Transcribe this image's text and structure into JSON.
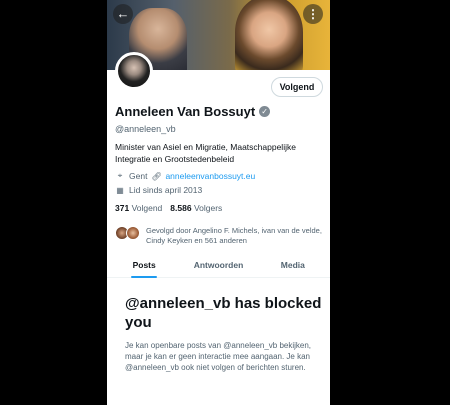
{
  "header": {
    "back_icon": "arrow-left-icon",
    "more_icon": "more-vertical-icon"
  },
  "profile": {
    "follow_label": "Volgend",
    "name": "Anneleen Van Bossuyt",
    "verified_icon": "verified-badge-icon",
    "handle": "@anneleen_vb",
    "bio": "Minister van Asiel en Migratie, Maatschappelijke Integratie en Grootstedenbeleid",
    "location": "Gent",
    "website": "anneleenvanbossuyt.eu",
    "joined": "Lid sinds april 2013",
    "following_count": "371",
    "following_label": "Volgend",
    "followers_count": "8.586",
    "followers_label": "Volgers",
    "followed_by": "Gevolgd door Angelino F. Michels, ivan van de velde, Cindy Keyken en 561 anderen"
  },
  "tabs": [
    {
      "label": "Posts",
      "active": true
    },
    {
      "label": "Antwoorden",
      "active": false
    },
    {
      "label": "Media",
      "active": false
    }
  ],
  "blocked": {
    "title": "@anneleen_vb has blocked you",
    "body": "Je kan openbare posts van @anneleen_vb bekijken, maar je kan er geen interactie mee aangaan. Je kan @anneleen_vb ook niet volgen of berichten sturen."
  },
  "colors": {
    "accent": "#1d9bf0",
    "text": "#0f1419",
    "muted": "#536471"
  }
}
